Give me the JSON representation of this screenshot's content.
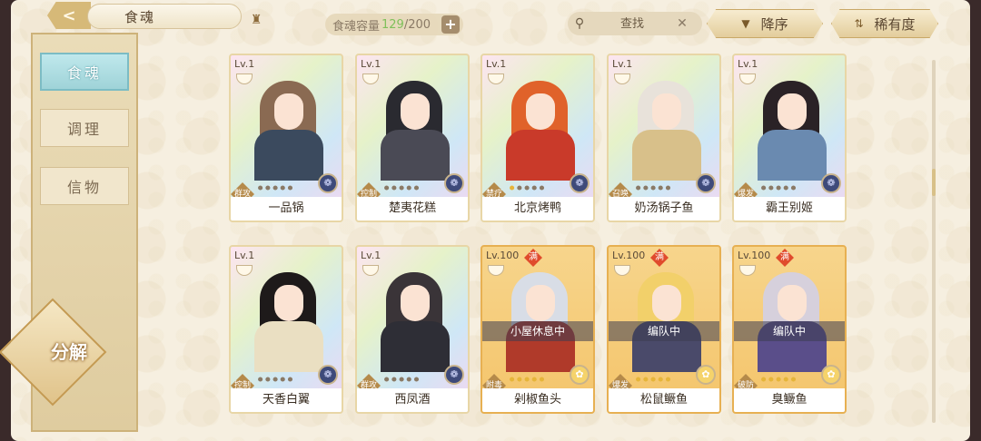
{
  "header": {
    "back_icon": "back-arrow-icon",
    "title": "食魂",
    "capacity_label": "食魂容量",
    "capacity_current": "129",
    "capacity_max": "/200",
    "plus": "+",
    "search_placeholder": "查找",
    "sort_order": "降序",
    "sort_key": "稀有度"
  },
  "sidebar": {
    "tabs": [
      "食魂",
      "调理",
      "信物"
    ],
    "decompose": "分解"
  },
  "colors": {
    "accent_gold": "#e6b53a",
    "active_tab": "#9fd3d8",
    "max_badge": "#e04b2c",
    "capacity_value": "#7fc05a"
  },
  "cards": [
    {
      "level": "Lv.1",
      "name": "一品锅",
      "role": "群攻",
      "stars": 0,
      "max": false,
      "status": "",
      "hair": "#8a6a52",
      "outfit": "#3b4a5e",
      "gold": false
    },
    {
      "level": "Lv.1",
      "name": "楚夷花糕",
      "role": "控制",
      "stars": 0,
      "max": false,
      "status": "",
      "hair": "#2a2a30",
      "outfit": "#4a4a55",
      "gold": false
    },
    {
      "level": "Lv.1",
      "name": "北京烤鸭",
      "role": "禁疗",
      "stars": 1,
      "max": false,
      "status": "",
      "hair": "#e0622a",
      "outfit": "#c93a2a",
      "gold": false
    },
    {
      "level": "Lv.1",
      "name": "奶汤锅子鱼",
      "role": "召唤",
      "stars": 0,
      "max": false,
      "status": "",
      "hair": "#e8e2da",
      "outfit": "#d8c08a",
      "gold": false
    },
    {
      "level": "Lv.1",
      "name": "霸王别姬",
      "role": "爆发",
      "stars": 0,
      "max": false,
      "status": "",
      "hair": "#2a2226",
      "outfit": "#6a8ab0",
      "gold": false
    },
    {
      "level": "Lv.1",
      "name": "天香白翼",
      "role": "控制",
      "stars": 0,
      "max": false,
      "status": "",
      "hair": "#1e1a1a",
      "outfit": "#eadfc2",
      "gold": false
    },
    {
      "level": "Lv.1",
      "name": "西凤酒",
      "role": "群攻",
      "stars": 0,
      "max": false,
      "status": "",
      "hair": "#3a3438",
      "outfit": "#2e2e36",
      "gold": false
    },
    {
      "level": "Lv.100",
      "name": "剁椒鱼头",
      "role": "附毒",
      "stars": 5,
      "max": true,
      "status": "小屋休息中",
      "hair": "#d8dde6",
      "outfit": "#b03a2a",
      "gold": true
    },
    {
      "level": "Lv.100",
      "name": "松鼠鳜鱼",
      "role": "爆发",
      "stars": 5,
      "max": true,
      "status": "编队中",
      "hair": "#f2d06a",
      "outfit": "#4a4a6a",
      "gold": true
    },
    {
      "level": "Lv.100",
      "name": "臭鳜鱼",
      "role": "破防",
      "stars": 5,
      "max": true,
      "status": "编队中",
      "hair": "#d6d0dc",
      "outfit": "#5a4e8a",
      "gold": true
    }
  ]
}
